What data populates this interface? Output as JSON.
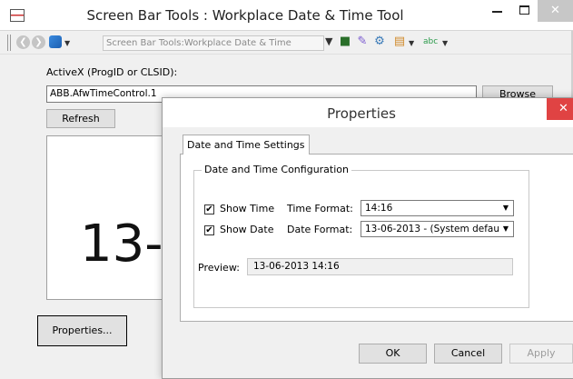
{
  "window": {
    "title": "Screen Bar Tools : Workplace Date & Time Tool",
    "close_glyph": "✕"
  },
  "toolbar": {
    "back_glyph": "❮",
    "forward_glyph": "❯",
    "dropdown_glyph": "▼",
    "address": "Screen Bar Tools:Workplace Date & Time",
    "address_arrow_glyph": "▼"
  },
  "main": {
    "activex_label": "ActiveX (ProgID or CLSID):",
    "activex_value": "ABB.AfwTimeControl.1",
    "browse_label": "Browse",
    "refresh_label": "Refresh",
    "preview_text": "13-06-2013 14:16",
    "properties_label": "Properties..."
  },
  "dialog": {
    "title": "Properties",
    "close_glyph": "✕",
    "tab_label": "Date and Time Settings",
    "group_title": "Date and Time Configuration",
    "show_time": {
      "label": "Show Time",
      "checked": true
    },
    "show_date": {
      "label": "Show Date",
      "checked": true
    },
    "check_glyph": "✔",
    "time_format_label": "Time Format:",
    "time_format_value": "14:16",
    "date_format_label": "Date Format:",
    "date_format_value": "13-06-2013 - (System defau",
    "combo_arrow_glyph": "▼",
    "preview_label": "Preview:",
    "preview_value": "13-06-2013 14:16",
    "ok_label": "OK",
    "cancel_label": "Cancel",
    "apply_label": "Apply"
  },
  "icons": [
    "app-icon",
    "back-icon",
    "forward-icon",
    "object-icon",
    "db-tree-icon",
    "edit-icon",
    "config-icon",
    "view-icon",
    "abc-icon"
  ]
}
